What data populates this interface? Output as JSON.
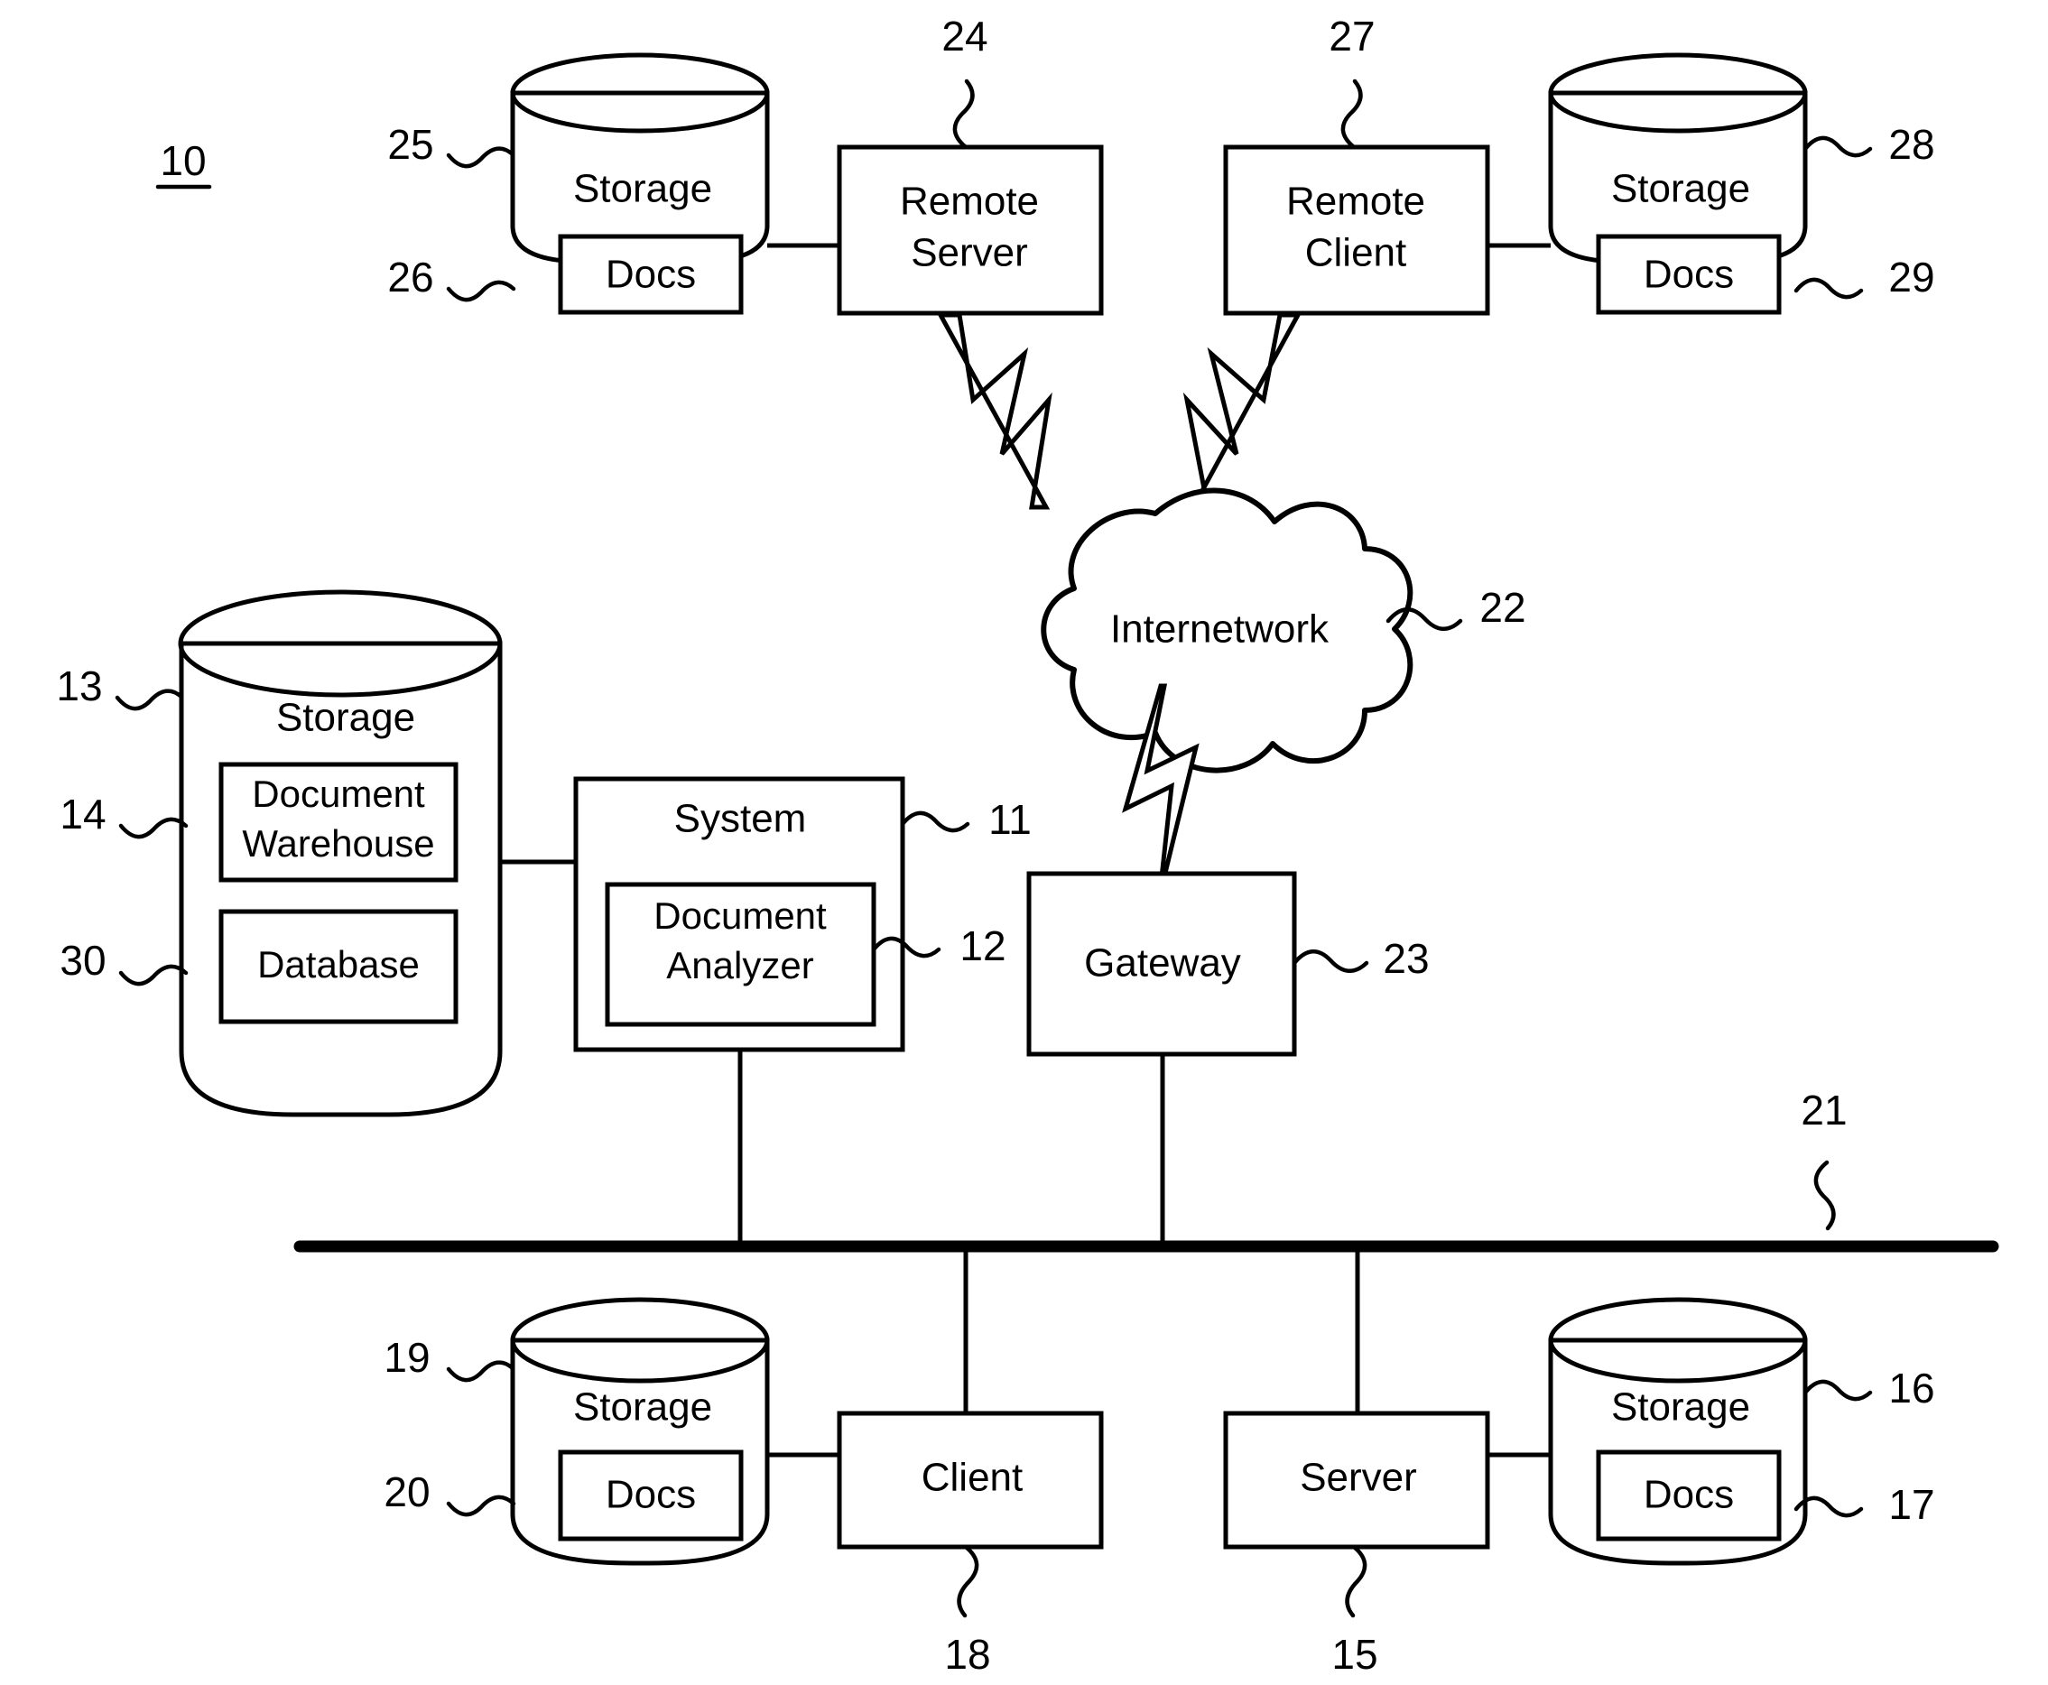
{
  "figure": {
    "number": "10",
    "type": "patent-network-diagram"
  },
  "nodes": {
    "storage_remote_server": {
      "title": "Storage",
      "inner": "Docs",
      "ref_outer": "25",
      "ref_inner": "26"
    },
    "remote_server": {
      "line1": "Remote",
      "line2": "Server",
      "ref": "24"
    },
    "remote_client": {
      "line1": "Remote",
      "line2": "Client",
      "ref": "27"
    },
    "storage_remote_client": {
      "title": "Storage",
      "inner": "Docs",
      "ref_outer": "28",
      "ref_inner": "29"
    },
    "internetwork": {
      "label": "Internetwork",
      "ref": "22"
    },
    "storage_main": {
      "title": "Storage",
      "inner1": "Document",
      "inner1b": "Warehouse",
      "inner2": "Database",
      "ref_outer": "13",
      "ref_inner1": "14",
      "ref_inner2": "30"
    },
    "system": {
      "title": "System",
      "inner1": "Document",
      "inner1b": "Analyzer",
      "ref_outer": "11",
      "ref_inner": "12"
    },
    "gateway": {
      "label": "Gateway",
      "ref": "23"
    },
    "network_bus": {
      "ref": "21"
    },
    "storage_client": {
      "title": "Storage",
      "inner": "Docs",
      "ref_outer": "19",
      "ref_inner": "20"
    },
    "client": {
      "label": "Client",
      "ref": "18"
    },
    "server": {
      "label": "Server",
      "ref": "15"
    },
    "storage_server": {
      "title": "Storage",
      "inner": "Docs",
      "ref_outer": "16",
      "ref_inner": "17"
    }
  },
  "colors": {
    "stroke": "#000000",
    "background": "#ffffff"
  }
}
